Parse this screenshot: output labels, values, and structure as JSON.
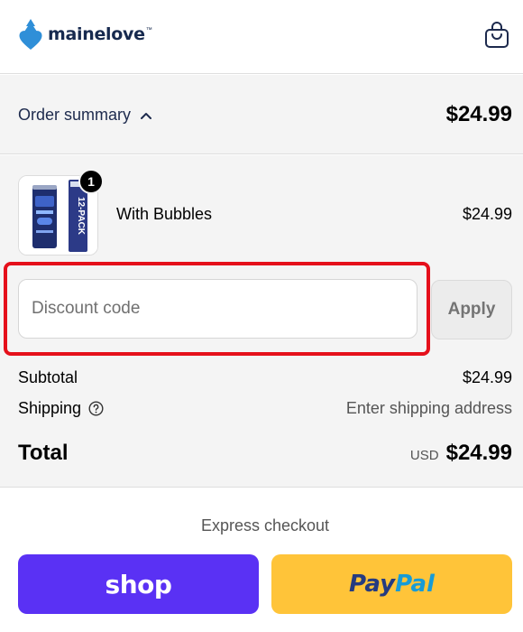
{
  "header": {
    "logo_text": "mainelove",
    "logo_tm": "™",
    "cart_icon": "shopping-bag-icon",
    "brand_color": "#172a4f",
    "logo_accent": "#2f8fd8"
  },
  "summary": {
    "toggle_label": "Order summary",
    "toggle_icon": "chevron-up-icon",
    "total": "$24.99"
  },
  "product": {
    "name": "With Bubbles",
    "price": "$24.99",
    "quantity": "1",
    "pack_label": "12-PACK"
  },
  "discount": {
    "placeholder": "Discount code",
    "value": "",
    "apply_label": "Apply",
    "highlight_color": "#e5101b"
  },
  "totals": {
    "subtotal_label": "Subtotal",
    "subtotal_value": "$24.99",
    "shipping_label": "Shipping",
    "shipping_value": "Enter shipping address",
    "total_label": "Total",
    "currency": "USD",
    "total_value": "$24.99"
  },
  "express": {
    "title": "Express checkout",
    "shop_label": "shop",
    "paypal_part1": "Pay",
    "paypal_part2": "Pal",
    "shop_color": "#5a31f4",
    "paypal_color": "#ffc439"
  }
}
